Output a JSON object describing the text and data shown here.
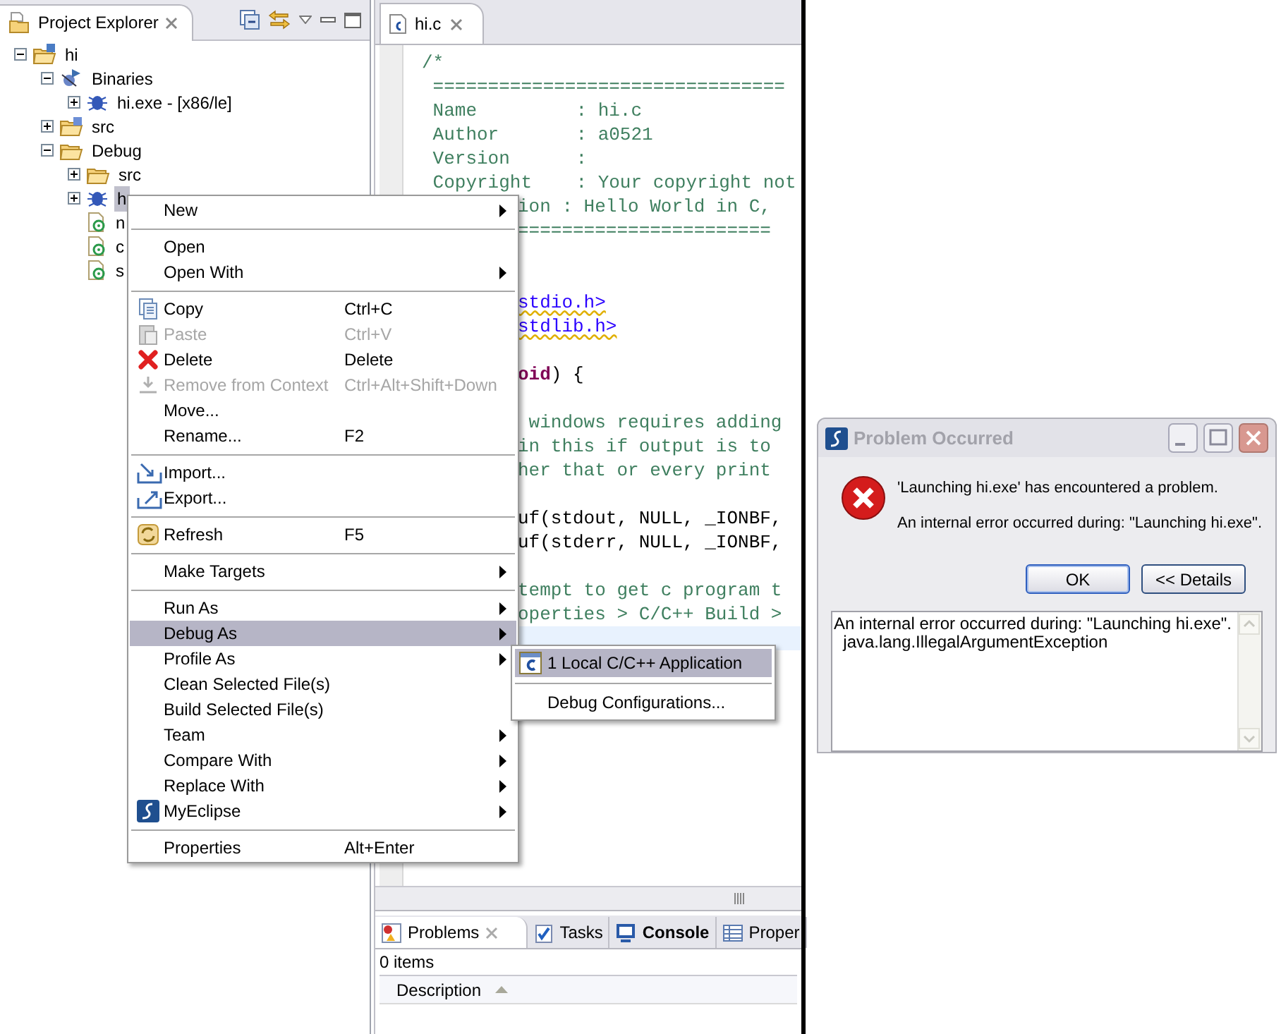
{
  "explorer": {
    "title": "Project Explorer",
    "tree": [
      {
        "label": "hi",
        "kind": "project",
        "expanded": true,
        "selected": false,
        "children": [
          {
            "label": "Binaries",
            "kind": "binaries",
            "expanded": true,
            "selected": false,
            "children": [
              {
                "label": "hi.exe - [x86/le]",
                "kind": "binary",
                "expanded": false,
                "selected": false
              }
            ]
          },
          {
            "label": "src",
            "kind": "source-folder",
            "expanded": false,
            "selected": false
          },
          {
            "label": "Debug",
            "kind": "folder",
            "expanded": true,
            "selected": false,
            "children": [
              {
                "label": "src",
                "kind": "folder",
                "expanded": false,
                "selected": false
              },
              {
                "label": "h",
                "kind": "binary",
                "expanded": false,
                "selected": true
              },
              {
                "label": "n",
                "kind": "file",
                "selected": false
              },
              {
                "label": "c",
                "kind": "file",
                "selected": false
              },
              {
                "label": "s",
                "kind": "file",
                "selected": false
              }
            ]
          }
        ]
      }
    ]
  },
  "editor": {
    "tab": "hi.c",
    "lines": [
      {
        "clipped": false,
        "current": false,
        "segments": [
          {
            "kind": "comment",
            "text": "/*"
          }
        ]
      },
      {
        "clipped": false,
        "current": false,
        "segments": [
          {
            "kind": "comment",
            "text": " ================================"
          }
        ]
      },
      {
        "clipped": false,
        "current": false,
        "segments": [
          {
            "kind": "comment",
            "text": " Name         : hi.c"
          }
        ]
      },
      {
        "clipped": false,
        "current": false,
        "segments": [
          {
            "kind": "comment",
            "text": " Author       : a0521"
          }
        ]
      },
      {
        "clipped": false,
        "current": false,
        "segments": [
          {
            "kind": "comment",
            "text": " Version      :"
          }
        ]
      },
      {
        "clipped": false,
        "current": false,
        "segments": [
          {
            "kind": "comment",
            "text": " Copyright    : Your copyright not"
          }
        ]
      },
      {
        "clipped": true,
        "current": false,
        "segments": [
          {
            "kind": "comment",
            "text": "ion : Hello World in C,"
          }
        ]
      },
      {
        "clipped": true,
        "current": false,
        "segments": [
          {
            "kind": "comment",
            "text": "======================="
          }
        ]
      },
      {
        "current": false
      },
      {
        "current": false
      },
      {
        "clipped": true,
        "current": false,
        "segments": [
          {
            "kind": "include",
            "text": "stdio.h>"
          }
        ]
      },
      {
        "clipped": true,
        "current": false,
        "segments": [
          {
            "kind": "include",
            "text": "stdlib.h>"
          }
        ]
      },
      {
        "current": false
      },
      {
        "clipped": true,
        "current": false,
        "segments": [
          {
            "kind": "keyword",
            "text": "oid"
          },
          {
            "kind": "plain",
            "text": ") {"
          }
        ]
      },
      {
        "current": false
      },
      {
        "clipped": true,
        "current": false,
        "segments": [
          {
            "kind": "comment",
            "text": " windows requires adding"
          }
        ]
      },
      {
        "clipped": true,
        "current": false,
        "segments": [
          {
            "kind": "comment",
            "text": "in this if output is to"
          }
        ]
      },
      {
        "clipped": true,
        "current": false,
        "segments": [
          {
            "kind": "comment",
            "text": "her that or every print"
          }
        ]
      },
      {
        "current": false
      },
      {
        "clipped": true,
        "current": false,
        "segments": [
          {
            "kind": "plain",
            "text": "uf(stdout, NULL, _IONBF,"
          }
        ]
      },
      {
        "clipped": true,
        "current": false,
        "segments": [
          {
            "kind": "plain",
            "text": "uf(stderr, NULL, _IONBF,"
          }
        ]
      },
      {
        "current": false
      },
      {
        "clipped": true,
        "current": false,
        "segments": [
          {
            "kind": "comment",
            "text": "tempt to get c program t"
          }
        ]
      },
      {
        "clipped": true,
        "current": false,
        "segments": [
          {
            "kind": "comment",
            "text": "operties > C/C++ Build >"
          }
        ]
      },
      {
        "current": true
      }
    ]
  },
  "context_menu": {
    "items": [
      {
        "kind": "item",
        "label": "New",
        "submenu": true,
        "disabled": false,
        "selected": false
      },
      {
        "kind": "separator"
      },
      {
        "kind": "item",
        "label": "Open",
        "submenu": false,
        "disabled": false,
        "selected": false
      },
      {
        "kind": "item",
        "label": "Open With",
        "submenu": true,
        "disabled": false,
        "selected": false
      },
      {
        "kind": "separator"
      },
      {
        "kind": "item",
        "label": "Copy",
        "shortcut": "Ctrl+C",
        "submenu": false,
        "disabled": false,
        "selected": false
      },
      {
        "kind": "item",
        "label": "Paste",
        "shortcut": "Ctrl+V",
        "submenu": false,
        "disabled": true,
        "selected": false
      },
      {
        "kind": "item",
        "label": "Delete",
        "shortcut": "Delete",
        "submenu": false,
        "disabled": false,
        "selected": false
      },
      {
        "kind": "item",
        "label": "Remove from Context",
        "shortcut": "Ctrl+Alt+Shift+Down",
        "submenu": false,
        "disabled": true,
        "selected": false
      },
      {
        "kind": "item",
        "label": "Move...",
        "submenu": false,
        "disabled": false,
        "selected": false
      },
      {
        "kind": "item",
        "label": "Rename...",
        "shortcut": "F2",
        "submenu": false,
        "disabled": false,
        "selected": false
      },
      {
        "kind": "separator"
      },
      {
        "kind": "item",
        "label": "Import...",
        "submenu": false,
        "disabled": false,
        "selected": false
      },
      {
        "kind": "item",
        "label": "Export...",
        "submenu": false,
        "disabled": false,
        "selected": false
      },
      {
        "kind": "separator"
      },
      {
        "kind": "item",
        "label": "Refresh",
        "shortcut": "F5",
        "submenu": false,
        "disabled": false,
        "selected": false
      },
      {
        "kind": "separator"
      },
      {
        "kind": "item",
        "label": "Make Targets",
        "submenu": true,
        "disabled": false,
        "selected": false
      },
      {
        "kind": "separator"
      },
      {
        "kind": "item",
        "label": "Run As",
        "submenu": true,
        "disabled": false,
        "selected": false
      },
      {
        "kind": "item",
        "label": "Debug As",
        "submenu": true,
        "disabled": false,
        "selected": true
      },
      {
        "kind": "item",
        "label": "Profile As",
        "submenu": true,
        "disabled": false,
        "selected": false
      },
      {
        "kind": "item",
        "label": "Clean Selected File(s)",
        "submenu": false,
        "disabled": false,
        "selected": false
      },
      {
        "kind": "item",
        "label": "Build Selected File(s)",
        "submenu": false,
        "disabled": false,
        "selected": false
      },
      {
        "kind": "item",
        "label": "Team",
        "submenu": true,
        "disabled": false,
        "selected": false
      },
      {
        "kind": "item",
        "label": "Compare With",
        "submenu": true,
        "disabled": false,
        "selected": false
      },
      {
        "kind": "item",
        "label": "Replace With",
        "submenu": true,
        "disabled": false,
        "selected": false
      },
      {
        "kind": "item",
        "label": "MyEclipse",
        "submenu": true,
        "disabled": false,
        "selected": false
      },
      {
        "kind": "separator"
      },
      {
        "kind": "item",
        "label": "Properties",
        "shortcut": "Alt+Enter",
        "submenu": false,
        "disabled": false,
        "selected": false
      }
    ]
  },
  "submenu": {
    "items": [
      {
        "kind": "item",
        "label": "1 Local C/C++ Application",
        "selected": true
      },
      {
        "kind": "separator"
      },
      {
        "kind": "item",
        "label": "Debug Configurations...",
        "selected": false
      }
    ]
  },
  "bottom_panel": {
    "tabs": [
      {
        "label": "Problems",
        "selected": true,
        "emphasized": false
      },
      {
        "label": "Tasks",
        "selected": false,
        "emphasized": false
      },
      {
        "label": "Console",
        "selected": false,
        "emphasized": true
      },
      {
        "label": "Proper",
        "selected": false,
        "emphasized": false
      }
    ],
    "count": "0 items",
    "columns": [
      {
        "label": "Description",
        "sorted": true
      }
    ]
  },
  "dialog": {
    "title": "Problem Occurred",
    "message": "'Launching hi.exe' has encountered a problem.",
    "reason": "An internal error occurred during: \"Launching hi.exe\".",
    "buttons": [
      {
        "label": "OK",
        "default": true
      },
      {
        "label": "<< Details",
        "default": false
      }
    ],
    "details": [
      "An internal error occurred during: \"Launching hi.exe\".",
      "  java.lang.IllegalArgumentException"
    ]
  }
}
